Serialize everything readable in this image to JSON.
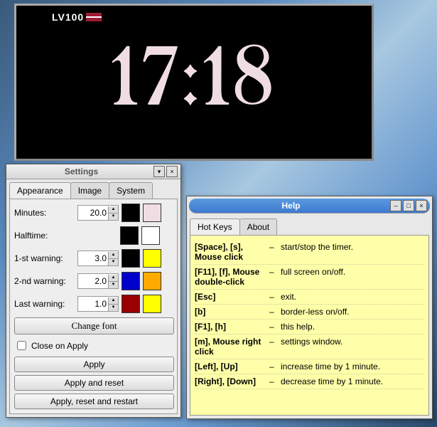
{
  "timer": {
    "logo": "LV100",
    "time": "17:18"
  },
  "settings": {
    "title": "Settings",
    "tabs": {
      "appearance": "Appearance",
      "image": "Image",
      "system": "System"
    },
    "fields": {
      "minutes_label": "Minutes:",
      "minutes_value": "20.0",
      "halftime_label": "Halftime:",
      "warn1_label": "1-st warning:",
      "warn1_value": "3.0",
      "warn2_label": "2-nd warning:",
      "warn2_value": "2.0",
      "last_label": "Last warning:",
      "last_value": "1.0"
    },
    "colors": {
      "minutes_fg": "#000000",
      "minutes_bg": "#f0dde3",
      "halftime_fg": "#000000",
      "halftime_bg": "#ffffff",
      "warn1_fg": "#000000",
      "warn1_bg": "#ffff00",
      "warn2_fg": "#0000cc",
      "warn2_bg": "#ffaa00",
      "last_fg": "#990000",
      "last_bg": "#ffff00"
    },
    "buttons": {
      "change_font": "Change font",
      "close_on_apply": "Close on Apply",
      "apply": "Apply",
      "apply_reset": "Apply and reset",
      "apply_reset_restart": "Apply, reset and restart"
    }
  },
  "help": {
    "title": "Help",
    "tabs": {
      "hotkeys": "Hot Keys",
      "about": "About"
    },
    "rows": [
      {
        "key": "[Space], [s], Mouse click",
        "desc": "start/stop the timer."
      },
      {
        "key": "[F11], [f], Mouse double-click",
        "desc": "full screen on/off."
      },
      {
        "key": "[Esc]",
        "desc": "exit."
      },
      {
        "key": "[b]",
        "desc": "border-less on/off."
      },
      {
        "key": "[F1], [h]",
        "desc": "this help."
      },
      {
        "key": "[m], Mouse right click",
        "desc": "settings window."
      },
      {
        "key": "[Left], [Up]",
        "desc": "increase time by 1 minute."
      },
      {
        "key": "[Right], [Down]",
        "desc": "decrease time by 1 minute."
      }
    ]
  }
}
